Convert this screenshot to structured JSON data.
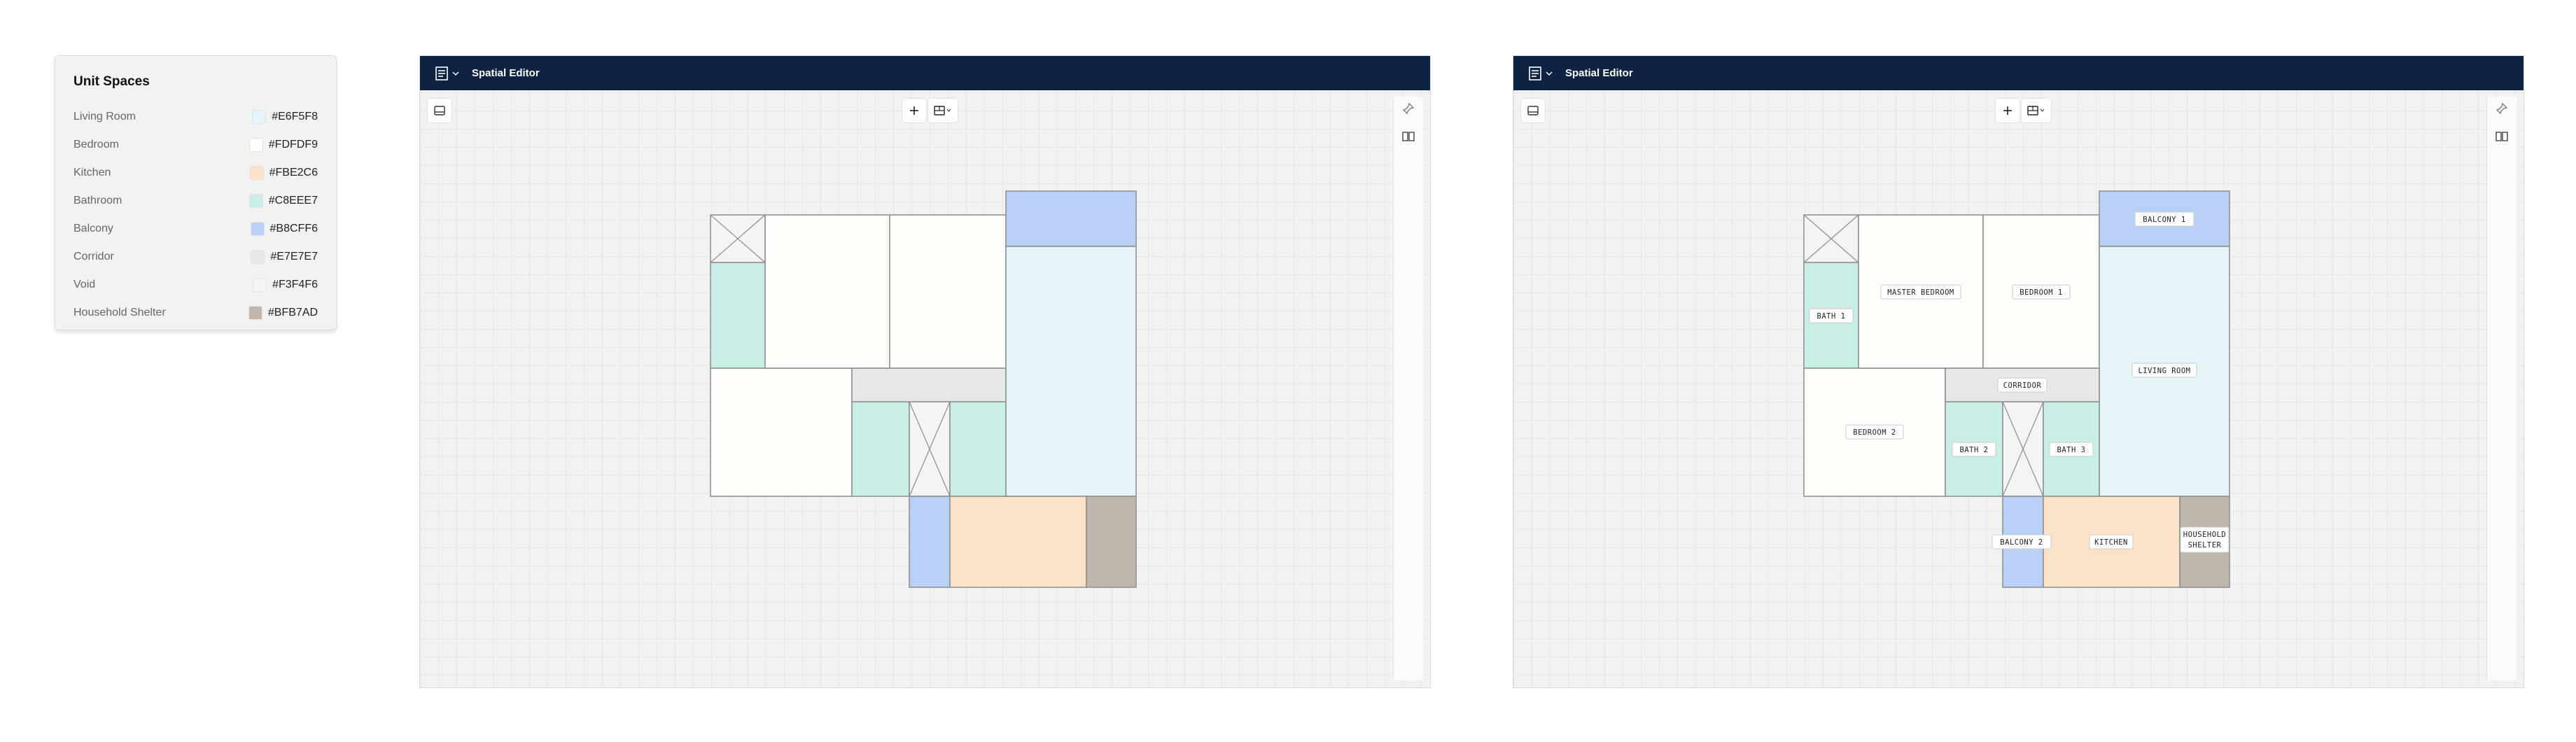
{
  "legend": {
    "title": "Unit Spaces",
    "items": [
      {
        "label": "Living Room",
        "hex": "#E6F5F8"
      },
      {
        "label": "Bedroom",
        "hex": "#FDFDF9"
      },
      {
        "label": "Kitchen",
        "hex": "#FBE2C6"
      },
      {
        "label": "Bathroom",
        "hex": "#C8EEE7"
      },
      {
        "label": "Balcony",
        "hex": "#B8CFF6"
      },
      {
        "label": "Corridor",
        "hex": "#E7E7E7"
      },
      {
        "label": "Void",
        "hex": "#F3F4F6"
      },
      {
        "label": "Household Shelter",
        "hex": "#BFB7AD"
      }
    ]
  },
  "editor": {
    "title": "Spatial Editor",
    "icons": {
      "menu": "document-lines-icon",
      "chevron": "chevron-down-icon",
      "left": "panel-toggle-icon",
      "add": "plus-icon",
      "layers": "layer-image-icon",
      "pin": "pin-icon",
      "book": "book-icon"
    }
  },
  "colors": {
    "topbar": "#0E2342",
    "void_stroke": "#8A8E8C"
  },
  "room_labels": {
    "balcony1": "BALCONY 1",
    "bath1": "BATH 1",
    "master": "MASTER BEDROOM",
    "bedroom1": "BEDROOM 1",
    "living": "LIVING ROOM",
    "corridor": "CORRIDOR",
    "bedroom2": "BEDROOM 2",
    "bath2": "BATH 2",
    "bath3": "BATH 3",
    "balcony2": "BALCONY 2",
    "kitchen": "KITCHEN",
    "shelter_line1": "HOUSEHOLD",
    "shelter_line2": "SHELTER"
  }
}
